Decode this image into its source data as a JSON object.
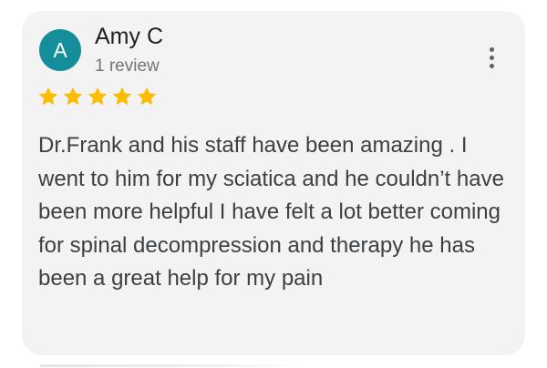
{
  "review": {
    "author": {
      "initial": "A",
      "name": "Amy C",
      "review_count": "1 review",
      "avatar_color": "#138e9a"
    },
    "rating": 5,
    "star_color": "#fbbc04",
    "text": "Dr.Frank and his staff have been amazing . I went to him for my sciatica and he couldn’t have been more helpful I have felt a lot better coming for spinal decompression and therapy he has been a great help for my pain",
    "menu_icon": "more-vert-icon"
  }
}
